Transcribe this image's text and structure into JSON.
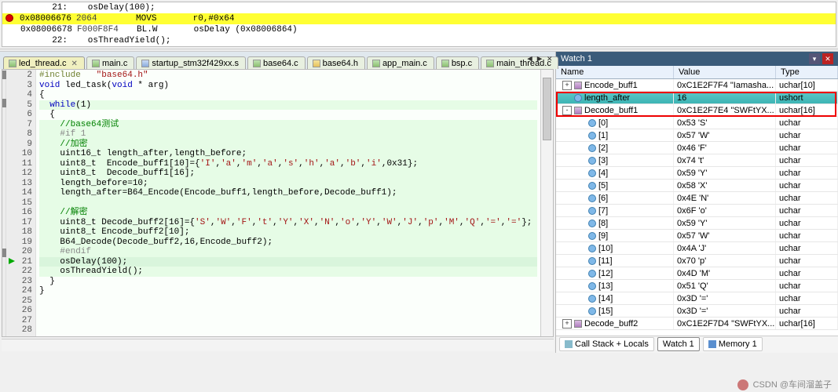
{
  "disasm": {
    "lines": [
      {
        "lineno": "21:",
        "code": "osDelay(100);",
        "hl": false,
        "bp": false
      },
      {
        "addr": "0x08006676",
        "bytes": "2064",
        "mnem": "MOVS",
        "args": "r0,#0x64",
        "hl": true,
        "bp": true
      },
      {
        "addr": "0x08006678",
        "bytes": "F000F8F4",
        "mnem": "BL.W",
        "args": "osDelay (0x08006864)",
        "hl": false,
        "bp": false
      },
      {
        "lineno": "22:",
        "code": "osThreadYield();",
        "hl": false,
        "bp": false
      }
    ]
  },
  "tabs": [
    {
      "label": "led_thread.c",
      "cls": "c",
      "active": true
    },
    {
      "label": "main.c",
      "cls": "c",
      "active": false
    },
    {
      "label": "startup_stm32f429xx.s",
      "cls": "s",
      "active": false
    },
    {
      "label": "base64.c",
      "cls": "c",
      "active": false
    },
    {
      "label": "base64.h",
      "cls": "h",
      "active": false
    },
    {
      "label": "app_main.c",
      "cls": "c",
      "active": false
    },
    {
      "label": "bsp.c",
      "cls": "c",
      "active": false
    },
    {
      "label": "main_thread.c",
      "cls": "c",
      "active": false
    }
  ],
  "close_glyph": "✕",
  "tabctrl": {
    "left": "◀",
    "right": "▶",
    "close": "✕"
  },
  "code": {
    "lines": [
      {
        "n": 2,
        "html": "<span class='pre'>#include</span>   <span class='str'>\"base64.h\"</span>",
        "green": false
      },
      {
        "n": 3,
        "html": "<span class='kw'>void</span> led_task(<span class='kw'>void</span> * arg)",
        "green": false
      },
      {
        "n": 4,
        "html": "{",
        "green": false
      },
      {
        "n": 5,
        "html": "  <span class='kw'>while</span>(<span class='num'>1</span>)",
        "green": true
      },
      {
        "n": 6,
        "html": "  {",
        "green": false
      },
      {
        "n": 7,
        "html": "    <span class='cmt'>//base64测试</span>",
        "green": true
      },
      {
        "n": 8,
        "html": "    <span class='gray'>#if 1</span>",
        "green": true
      },
      {
        "n": 9,
        "html": "    <span class='cmt'>//加密</span>",
        "green": true
      },
      {
        "n": 10,
        "html": "    uint16_t length_after,length_before;",
        "green": true
      },
      {
        "n": 11,
        "html": "    uint8_t  Encode_buff1[<span class='num'>10</span>]={<span class='str'>'I'</span>,<span class='str'>'a'</span>,<span class='str'>'m'</span>,<span class='str'>'a'</span>,<span class='str'>'s'</span>,<span class='str'>'h'</span>,<span class='str'>'a'</span>,<span class='str'>'b'</span>,<span class='str'>'i'</span>,<span class='num'>0x31</span>};",
        "green": true
      },
      {
        "n": 12,
        "html": "    uint8_t  Decode_buff1[<span class='num'>16</span>];",
        "green": true
      },
      {
        "n": 13,
        "html": "    length_before=<span class='num'>10</span>;",
        "green": true
      },
      {
        "n": 14,
        "html": "    length_after=B64_Encode(Encode_buff1,length_before,Decode_buff1);",
        "green": true
      },
      {
        "n": 15,
        "html": "",
        "green": true
      },
      {
        "n": 16,
        "html": "    <span class='cmt'>//解密</span>",
        "green": true
      },
      {
        "n": 17,
        "html": "    uint8_t Decode_buff2[<span class='num'>16</span>]={<span class='str'>'S'</span>,<span class='str'>'W'</span>,<span class='str'>'F'</span>,<span class='str'>'t'</span>,<span class='str'>'Y'</span>,<span class='str'>'X'</span>,<span class='str'>'N'</span>,<span class='str'>'o'</span>,<span class='str'>'Y'</span>,<span class='str'>'W'</span>,<span class='str'>'J'</span>,<span class='str'>'p'</span>,<span class='str'>'M'</span>,<span class='str'>'Q'</span>,<span class='str'>'='</span>,<span class='str'>'='</span>};",
        "green": true
      },
      {
        "n": 18,
        "html": "    uint8_t Encode_buff2[<span class='num'>10</span>];",
        "green": true
      },
      {
        "n": 19,
        "html": "    B64_Decode(Decode_buff2,<span class='num'>16</span>,Encode_buff2);",
        "green": true
      },
      {
        "n": 20,
        "html": "    <span class='gray'>#endif</span>",
        "green": true
      },
      {
        "n": 21,
        "html": "    osDelay(<span class='num'>100</span>);",
        "green": true,
        "exec": true
      },
      {
        "n": 22,
        "html": "    osThreadYield();",
        "green": true
      },
      {
        "n": 23,
        "html": "  }",
        "green": false
      },
      {
        "n": 24,
        "html": "}",
        "green": false
      },
      {
        "n": 25,
        "html": "",
        "green": false
      },
      {
        "n": 26,
        "html": "",
        "green": false
      },
      {
        "n": 27,
        "html": "",
        "green": false
      },
      {
        "n": 28,
        "html": "",
        "green": false
      }
    ]
  },
  "watch": {
    "title": "Watch 1",
    "headers": {
      "name": "Name",
      "value": "Value",
      "type": "Type"
    },
    "rows": [
      {
        "depth": 0,
        "kind": "obj",
        "exp": "+",
        "name": "Encode_buff1",
        "value": "0xC1E2F7F4 \"Iamasha...",
        "type": "uchar[10]"
      },
      {
        "depth": 0,
        "kind": "var",
        "exp": "",
        "name": "length_after",
        "value": "16",
        "type": "ushort",
        "sel": true
      },
      {
        "depth": 0,
        "kind": "obj",
        "exp": "-",
        "name": "Decode_buff1",
        "value": "0xC1E2F7E4 \"SWFtYX...",
        "type": "uchar[16]"
      },
      {
        "depth": 1,
        "kind": "var",
        "name": "[0]",
        "value": "0x53 'S'",
        "type": "uchar"
      },
      {
        "depth": 1,
        "kind": "var",
        "name": "[1]",
        "value": "0x57 'W'",
        "type": "uchar"
      },
      {
        "depth": 1,
        "kind": "var",
        "name": "[2]",
        "value": "0x46 'F'",
        "type": "uchar"
      },
      {
        "depth": 1,
        "kind": "var",
        "name": "[3]",
        "value": "0x74 't'",
        "type": "uchar"
      },
      {
        "depth": 1,
        "kind": "var",
        "name": "[4]",
        "value": "0x59 'Y'",
        "type": "uchar"
      },
      {
        "depth": 1,
        "kind": "var",
        "name": "[5]",
        "value": "0x58 'X'",
        "type": "uchar"
      },
      {
        "depth": 1,
        "kind": "var",
        "name": "[6]",
        "value": "0x4E 'N'",
        "type": "uchar"
      },
      {
        "depth": 1,
        "kind": "var",
        "name": "[7]",
        "value": "0x6F 'o'",
        "type": "uchar"
      },
      {
        "depth": 1,
        "kind": "var",
        "name": "[8]",
        "value": "0x59 'Y'",
        "type": "uchar"
      },
      {
        "depth": 1,
        "kind": "var",
        "name": "[9]",
        "value": "0x57 'W'",
        "type": "uchar"
      },
      {
        "depth": 1,
        "kind": "var",
        "name": "[10]",
        "value": "0x4A 'J'",
        "type": "uchar"
      },
      {
        "depth": 1,
        "kind": "var",
        "name": "[11]",
        "value": "0x70 'p'",
        "type": "uchar"
      },
      {
        "depth": 1,
        "kind": "var",
        "name": "[12]",
        "value": "0x4D 'M'",
        "type": "uchar"
      },
      {
        "depth": 1,
        "kind": "var",
        "name": "[13]",
        "value": "0x51 'Q'",
        "type": "uchar"
      },
      {
        "depth": 1,
        "kind": "var",
        "name": "[14]",
        "value": "0x3D '='",
        "type": "uchar"
      },
      {
        "depth": 1,
        "kind": "var",
        "name": "[15]",
        "value": "0x3D '='",
        "type": "uchar"
      },
      {
        "depth": 0,
        "kind": "obj",
        "exp": "+",
        "name": "Decode_buff2",
        "value": "0xC1E2F7D4 \"SWFtYX...",
        "type": "uchar[16]"
      }
    ],
    "footer_tabs": [
      {
        "label": "Call Stack + Locals",
        "active": false,
        "icon": "cs"
      },
      {
        "label": "Watch 1",
        "active": true,
        "icon": ""
      },
      {
        "label": "Memory 1",
        "active": false,
        "icon": "mem"
      }
    ]
  },
  "footer": {
    "text": "CSDN @车间溜盖子"
  }
}
